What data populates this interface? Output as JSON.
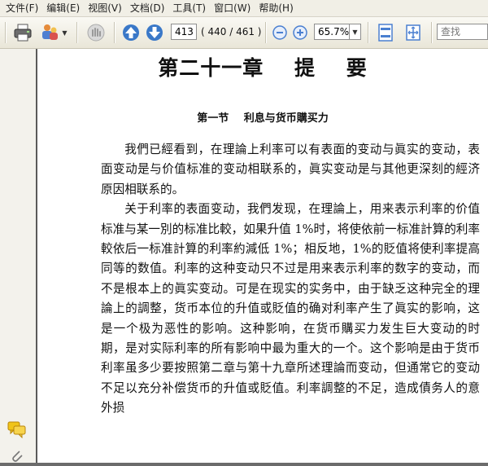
{
  "menu": [
    "文件(F)",
    "编辑(E)",
    "视图(V)",
    "文档(D)",
    "工具(T)",
    "窗口(W)",
    "帮助(H)"
  ],
  "toolbar": {
    "page_current": "413",
    "page_total": "( 440 / 461 )",
    "zoom": "65.7%",
    "search_placeholder": "查找"
  },
  "colors": {
    "nav_arrow": "#3a78c8",
    "zoom_button": "#4a7fd0"
  },
  "document": {
    "chapter_title": "第二十一章  提  要",
    "section_title": "第一节  利息与货币購买力",
    "paragraphs": [
      "我們已經看到，在理論上利率可以有表面的变动与眞实的变动，表面变动是与价值标准的变动相联系的，眞实变动是与其他更深刻的經济原因相联系的。",
      "关于利率的表面变动，我們发现，在理論上，用来表示利率的价值标准与某一別的标准比較，如果升值 1%时，将使依前一标准計算的利率較依后一标准計算的利率約減低 1%；相反地，1%的貶值将使利率提高同等的数值。利率的这种变动只不过是用来表示利率的数字的变动，而不是根本上的眞实变动。可是在现实的实务中，由于缺乏这种完全的理論上的調整，货币本位的升值或貶值的确对利率产生了眞实的影响，这是一个极为恶性的影响。这种影响，在货币購买力发生巨大变动的时期，是对实际利率的所有影响中最为重大的一个。这个影响是由于货币利率虽多少要按照第二章与第十九章所述理論而变动，但通常它的变动不足以充分补偿货币的升值或貶值。利率調整的不足，造成債务人的意外损"
    ]
  }
}
